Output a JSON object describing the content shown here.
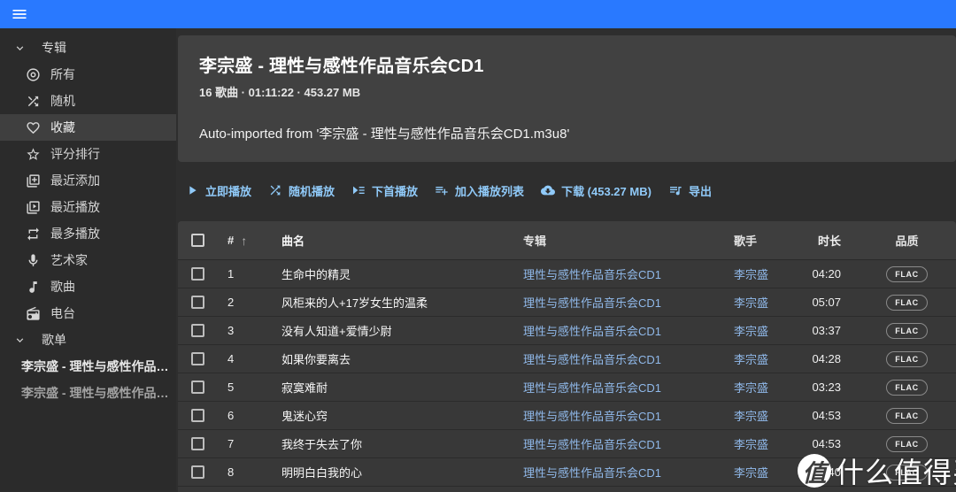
{
  "appbar": {
    "menu_icon": "menu",
    "color": "#2979ff"
  },
  "sidebar": {
    "items": [
      {
        "type": "group",
        "icon": "chevron-down",
        "label": "专辑",
        "name": "albums-group"
      },
      {
        "type": "item",
        "icon": "album",
        "label": "所有",
        "name": "all"
      },
      {
        "type": "item",
        "icon": "shuffle",
        "label": "随机",
        "name": "random"
      },
      {
        "type": "item",
        "icon": "heart",
        "label": "收藏",
        "name": "favourites",
        "active": true
      },
      {
        "type": "item",
        "icon": "star",
        "label": "评分排行",
        "name": "top-rated"
      },
      {
        "type": "item",
        "icon": "library-add",
        "label": "最近添加",
        "name": "recently-added"
      },
      {
        "type": "item",
        "icon": "library-play",
        "label": "最近播放",
        "name": "recently-played"
      },
      {
        "type": "item",
        "icon": "repeat",
        "label": "最多播放",
        "name": "most-played"
      },
      {
        "type": "item",
        "icon": "microphone",
        "label": "艺术家",
        "name": "artists"
      },
      {
        "type": "item",
        "icon": "music-note",
        "label": "歌曲",
        "name": "songs"
      },
      {
        "type": "item",
        "icon": "radio",
        "label": "电台",
        "name": "radios"
      },
      {
        "type": "group",
        "icon": "chevron-down",
        "label": "歌单",
        "name": "playlists-group"
      },
      {
        "type": "playlist",
        "label": "李宗盛 - 理性与感性作品…",
        "name": "playlist-1"
      },
      {
        "type": "playlist",
        "label": "李宗盛 - 理性与感性作品…",
        "name": "playlist-2",
        "dim": true
      }
    ]
  },
  "album": {
    "title": "李宗盛 - 理性与感性作品音乐会CD1",
    "stats": "16 歌曲 · 01:11:22 · 453.27 MB",
    "comment": "Auto-imported from '李宗盛 - 理性与感性作品音乐会CD1.m3u8'"
  },
  "actions": [
    {
      "icon": "play",
      "label": "立即播放",
      "name": "play-now"
    },
    {
      "icon": "shuffle",
      "label": "随机播放",
      "name": "shuffle-play"
    },
    {
      "icon": "play-next",
      "label": "下首播放",
      "name": "play-next"
    },
    {
      "icon": "playlist-add",
      "label": "加入播放列表",
      "name": "add-to-playlist"
    },
    {
      "icon": "cloud-download",
      "label": "下载 (453.27 MB)",
      "name": "download"
    },
    {
      "icon": "playlist-music",
      "label": "导出",
      "name": "export"
    }
  ],
  "table": {
    "headers": {
      "number": "#",
      "sort_arrow": "↑",
      "title": "曲名",
      "album": "专辑",
      "artist": "歌手",
      "duration": "时长",
      "quality": "品质"
    },
    "rows": [
      {
        "number": "1",
        "title": "生命中的精灵",
        "album": "理性与感性作品音乐会CD1",
        "artist": "李宗盛",
        "duration": "04:20",
        "quality": "FLAC"
      },
      {
        "number": "2",
        "title": "风柜来的人+17岁女生的温柔",
        "album": "理性与感性作品音乐会CD1",
        "artist": "李宗盛",
        "duration": "05:07",
        "quality": "FLAC"
      },
      {
        "number": "3",
        "title": "没有人知道+爱情少尉",
        "album": "理性与感性作品音乐会CD1",
        "artist": "李宗盛",
        "duration": "03:37",
        "quality": "FLAC"
      },
      {
        "number": "4",
        "title": "如果你要离去",
        "album": "理性与感性作品音乐会CD1",
        "artist": "李宗盛",
        "duration": "04:28",
        "quality": "FLAC"
      },
      {
        "number": "5",
        "title": "寂寞难耐",
        "album": "理性与感性作品音乐会CD1",
        "artist": "李宗盛",
        "duration": "03:23",
        "quality": "FLAC"
      },
      {
        "number": "6",
        "title": "鬼迷心窍",
        "album": "理性与感性作品音乐会CD1",
        "artist": "李宗盛",
        "duration": "04:53",
        "quality": "FLAC"
      },
      {
        "number": "7",
        "title": "我终于失去了你",
        "album": "理性与感性作品音乐会CD1",
        "artist": "李宗盛",
        "duration": "04:53",
        "quality": "FLAC"
      },
      {
        "number": "8",
        "title": "明明白白我的心",
        "album": "理性与感性作品音乐会CD1",
        "artist": "李宗盛",
        "duration": "04:40",
        "quality": "FLAC"
      }
    ]
  },
  "watermark": {
    "logo": "值",
    "text": "什么值得买"
  },
  "colors": {
    "appbar": "#2979ff",
    "action_link": "#90caf9",
    "table_link": "#90b9ea"
  }
}
